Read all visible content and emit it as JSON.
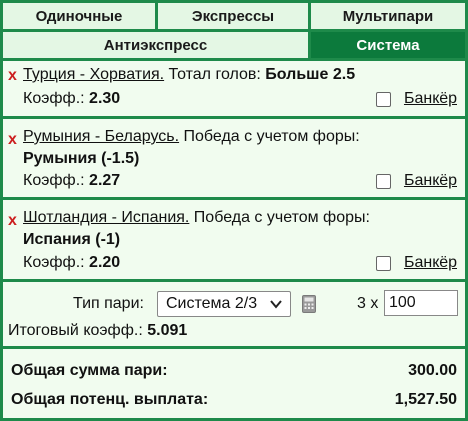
{
  "tabs": {
    "single": "Одиночные",
    "express": "Экспрессы",
    "multi": "Мультипари",
    "antiexpress": "Антиэкспресс",
    "system": "Система"
  },
  "active_tab": "Система",
  "bets": [
    {
      "event": "Турция - Хорватия.",
      "market": " Тотал голов: ",
      "selection": "Больше 2.5",
      "coef_label": "Коэфф.: ",
      "coef": "2.30",
      "banker_label": "Банкёр",
      "banker_checked": false
    },
    {
      "event": "Румыния - Беларусь.",
      "market": " Победа с учетом форы:",
      "selection": "Румыния (-1.5)",
      "coef_label": "Коэфф.: ",
      "coef": "2.27",
      "banker_label": "Банкёр",
      "banker_checked": false
    },
    {
      "event": "Шотландия - Испания.",
      "market": " Победа с учетом форы:",
      "selection": "Испания (-1)",
      "coef_label": "Коэфф.: ",
      "coef": "2.20",
      "banker_label": "Банкёр",
      "banker_checked": false
    }
  ],
  "remove_glyph": "x",
  "settings": {
    "bet_type_label": "Тип пари:",
    "bet_type_value": "Система 2/3",
    "multiplier_label": "3 x",
    "stake_value": "100",
    "total_coef_label": "Итоговый коэфф.: ",
    "total_coef_value": "5.091"
  },
  "totals": {
    "total_stake_label": "Общая сумма пари:",
    "total_stake_value": "300.00",
    "potential_payout_label": "Общая потенц. выплата:",
    "potential_payout_value": "1,527.50"
  },
  "colors": {
    "border_green": "#1e8a4a",
    "active_tab": "#0c7a3c",
    "tab_bg": "#e4f7e4",
    "panel_bg": "#f1fcef",
    "remove_red": "#cc1f1f"
  },
  "icons": {
    "remove": "close-icon",
    "select_arrow": "chevron-down-icon",
    "calculator": "calculator-icon"
  }
}
